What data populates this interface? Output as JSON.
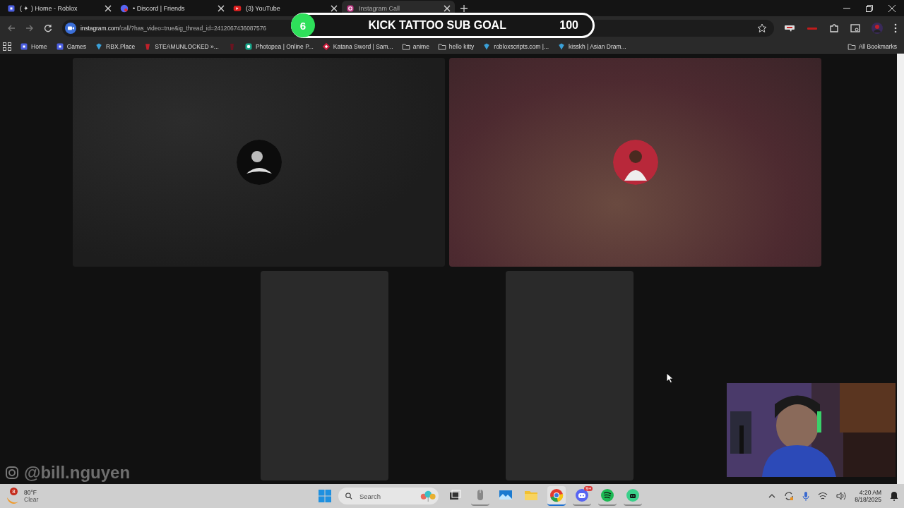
{
  "browser": {
    "tabs": [
      {
        "title": "( ✦ ) Home - Roblox",
        "kind": "roblox",
        "selected": false
      },
      {
        "title": "• Discord | Friends",
        "kind": "discord",
        "selected": false
      },
      {
        "title": "(3) YouTube",
        "kind": "youtube",
        "selected": false
      },
      {
        "title": "Instagram Call",
        "kind": "instagram",
        "selected": true
      }
    ],
    "address_bar": {
      "host": "instagram.com",
      "path": "/call/?has_video=true&ig_thread_id=2412067436087576"
    },
    "bookmarks": [
      {
        "label": "Home",
        "kind": "roblox"
      },
      {
        "label": "Games",
        "kind": "roblox"
      },
      {
        "label": "RBX.Place",
        "kind": "site"
      },
      {
        "label": "STEAMUNLOCKED »...",
        "kind": "steam"
      },
      {
        "label": "Photopea | Online P...",
        "kind": "photopea"
      },
      {
        "label": "Katana Sword | Sam...",
        "kind": "katana"
      },
      {
        "label": "anime",
        "kind": "folder"
      },
      {
        "label": "hello kitty",
        "kind": "folder"
      },
      {
        "label": "robloxscripts.com |...",
        "kind": "site"
      },
      {
        "label": "kisskh | Asian Dram...",
        "kind": "site"
      }
    ],
    "all_bookmarks": "All Bookmarks"
  },
  "call": {
    "tiles": [
      {
        "kind": "dark"
      },
      {
        "kind": "warm"
      },
      {
        "kind": "blank"
      },
      {
        "kind": "blank"
      }
    ]
  },
  "stream_overlay": {
    "goal_count": "6",
    "goal_title": "KICK TATTOO SUB GOAL",
    "goal_target": "100",
    "handle": "@bill.nguyen"
  },
  "taskbar": {
    "weather": {
      "badge": "8",
      "temperature": "80°F",
      "condition": "Clear"
    },
    "search": {
      "placeholder": "Search"
    },
    "apps": [
      {
        "kind": "taskview",
        "running": false,
        "selected": false
      },
      {
        "kind": "mouse",
        "running": true,
        "selected": false
      },
      {
        "kind": "photos",
        "running": false,
        "selected": false
      },
      {
        "kind": "explorer",
        "running": false,
        "selected": false
      },
      {
        "kind": "chrome",
        "running": true,
        "selected": true
      },
      {
        "kind": "discord",
        "running": true,
        "selected": false,
        "badge": "9+"
      },
      {
        "kind": "spotify",
        "running": true,
        "selected": false
      },
      {
        "kind": "green",
        "running": true,
        "selected": false
      }
    ],
    "time": "4:20 AM",
    "date": "8/18/2025"
  }
}
